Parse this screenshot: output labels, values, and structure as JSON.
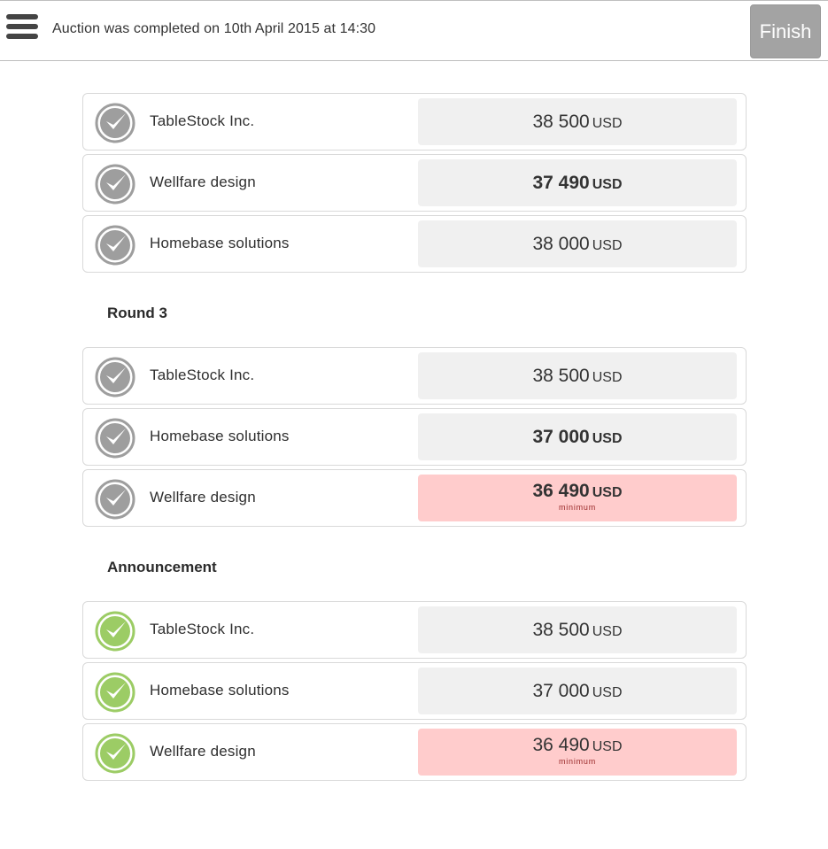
{
  "header": {
    "status": "Auction was completed on 10th April 2015 at 14:30",
    "finish_label": "Finish"
  },
  "colors": {
    "check_grey": "#9e9e9e",
    "check_green": "#9ccc65",
    "minimum_bg": "#ffcccc",
    "bid_bg": "#f0f0f0"
  },
  "sections": [
    {
      "title": "",
      "rows": [
        {
          "bidder": "TableStock Inc.",
          "amount": "38 500",
          "currency": "USD",
          "bold": false,
          "minimum": false,
          "status_icon": "check-grey-icon"
        },
        {
          "bidder": "Wellfare design",
          "amount": "37 490",
          "currency": "USD",
          "bold": true,
          "minimum": false,
          "status_icon": "check-grey-icon"
        },
        {
          "bidder": "Homebase solutions",
          "amount": "38 000",
          "currency": "USD",
          "bold": false,
          "minimum": false,
          "status_icon": "check-grey-icon"
        }
      ]
    },
    {
      "title": "Round 3",
      "rows": [
        {
          "bidder": "TableStock Inc.",
          "amount": "38 500",
          "currency": "USD",
          "bold": false,
          "minimum": false,
          "status_icon": "check-grey-icon"
        },
        {
          "bidder": "Homebase solutions",
          "amount": "37 000",
          "currency": "USD",
          "bold": true,
          "minimum": false,
          "status_icon": "check-grey-icon"
        },
        {
          "bidder": "Wellfare design",
          "amount": "36 490",
          "currency": "USD",
          "bold": true,
          "minimum": true,
          "minimum_label": "minimum",
          "status_icon": "check-grey-icon"
        }
      ]
    },
    {
      "title": "Announcement",
      "rows": [
        {
          "bidder": "TableStock Inc.",
          "amount": "38 500",
          "currency": "USD",
          "bold": false,
          "minimum": false,
          "status_icon": "check-green-icon"
        },
        {
          "bidder": "Homebase solutions",
          "amount": "37 000",
          "currency": "USD",
          "bold": false,
          "minimum": false,
          "status_icon": "check-green-icon"
        },
        {
          "bidder": "Wellfare design",
          "amount": "36 490",
          "currency": "USD",
          "bold": false,
          "minimum": true,
          "minimum_label": "minimum",
          "status_icon": "check-green-icon"
        }
      ]
    }
  ]
}
